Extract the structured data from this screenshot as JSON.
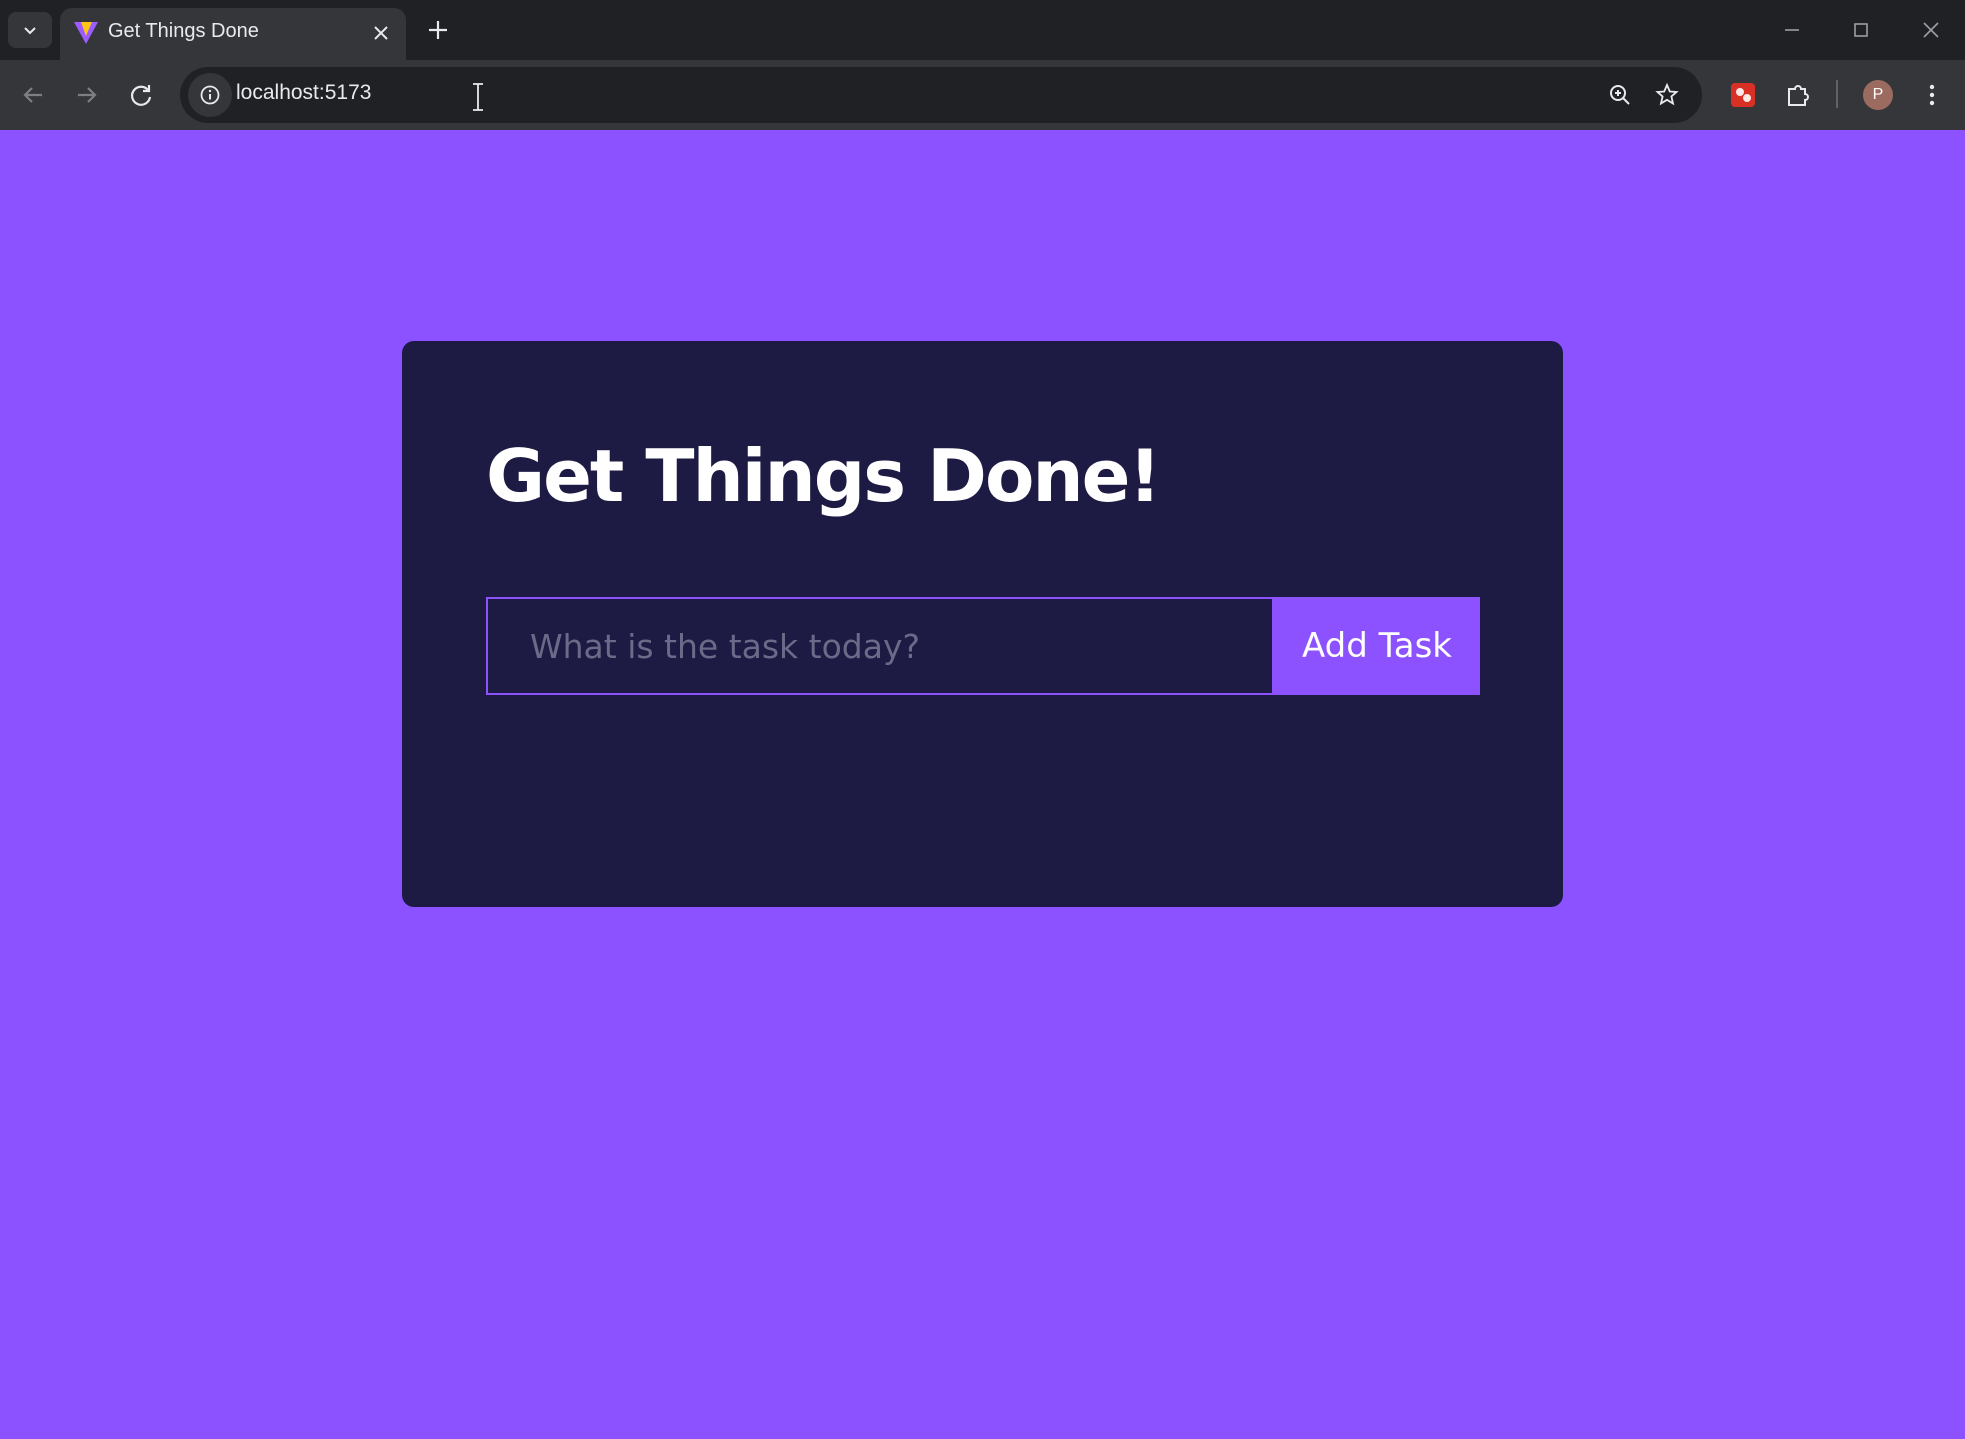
{
  "browser": {
    "tab": {
      "title": "Get Things Done",
      "favicon": "vite-logo-icon"
    },
    "address_bar": {
      "url": "localhost:5173"
    },
    "profile_initial": "P",
    "icons": [
      "tab-search-icon",
      "close-icon",
      "new-tab-icon",
      "minimize-icon",
      "maximize-icon",
      "window-close-icon",
      "back-icon",
      "forward-icon",
      "reload-icon",
      "site-info-icon",
      "zoom-icon",
      "bookmark-star-icon",
      "extension-app-icon",
      "extensions-puzzle-icon",
      "more-menu-icon"
    ]
  },
  "app": {
    "heading": "Get Things Done!",
    "input_placeholder": "What is the task today?",
    "input_value": "",
    "add_button_label": "Add Task"
  },
  "colors": {
    "page_background": "#8c52ff",
    "card_background": "#1d1a43",
    "accent": "#8c52ff",
    "text": "#ffffff"
  }
}
